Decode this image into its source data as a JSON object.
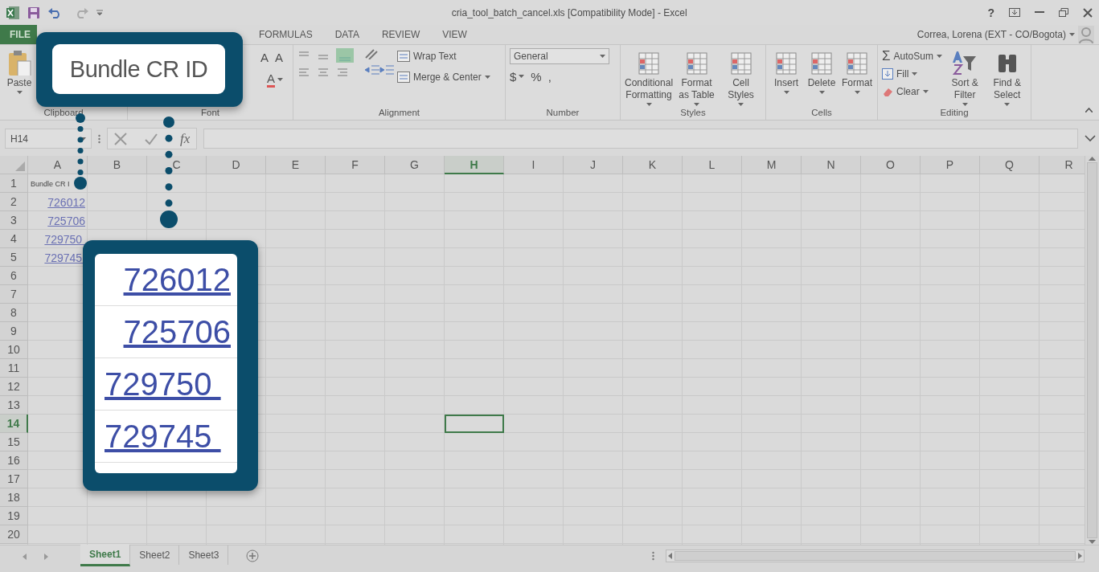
{
  "window": {
    "title": "cria_tool_batch_cancel.xls  [Compatibility Mode] - Excel",
    "help": "?",
    "user": "Correa, Lorena (EXT - CO/Bogota)"
  },
  "ribbon_tabs": [
    {
      "label": "FILE",
      "kind": "file"
    },
    {
      "label": "FORMULAS",
      "kind": "tab"
    },
    {
      "label": "DATA",
      "kind": "tab"
    },
    {
      "label": "REVIEW",
      "kind": "tab"
    },
    {
      "label": "VIEW",
      "kind": "tab"
    }
  ],
  "ribbon_groups": [
    {
      "name": "Clipboard",
      "commands": [
        {
          "kind": "large",
          "label": "Paste",
          "dropdown": true
        }
      ]
    },
    {
      "name": "Font",
      "commands": [
        {
          "kind": "glyph",
          "label": "A"
        },
        {
          "kind": "glyph",
          "label": "A"
        },
        {
          "kind": "color",
          "label": "A",
          "dropdown": true
        }
      ]
    },
    {
      "name": "Alignment",
      "commands": [
        {
          "kind": "small",
          "label": "Wrap Text",
          "dropdown": false
        },
        {
          "kind": "small",
          "label": "Merge & Center",
          "dropdown": true
        }
      ]
    },
    {
      "name": "Number",
      "format": "General",
      "commands": [
        {
          "kind": "glyph",
          "label": "$",
          "dropdown": true
        },
        {
          "kind": "glyph",
          "label": "%"
        },
        {
          "kind": "glyph",
          "label": ","
        }
      ]
    },
    {
      "name": "Styles",
      "commands": [
        {
          "kind": "large",
          "label": "Conditional Formatting",
          "dropdown": true
        },
        {
          "kind": "large",
          "label": "Format as Table",
          "dropdown": true
        },
        {
          "kind": "large",
          "label": "Cell Styles",
          "dropdown": true
        }
      ]
    },
    {
      "name": "Cells",
      "commands": [
        {
          "kind": "large",
          "label": "Insert",
          "dropdown": true
        },
        {
          "kind": "large",
          "label": "Delete",
          "dropdown": true
        },
        {
          "kind": "large",
          "label": "Format",
          "dropdown": true
        }
      ]
    },
    {
      "name": "Editing",
      "commands": [
        {
          "kind": "small",
          "label": "AutoSum",
          "glyph": "Σ",
          "dropdown": true
        },
        {
          "kind": "small",
          "label": "Fill",
          "dropdown": true
        },
        {
          "kind": "small",
          "label": "Clear",
          "dropdown": true
        },
        {
          "kind": "large",
          "label": "Sort & Filter",
          "dropdown": true
        },
        {
          "kind": "large",
          "label": "Find & Select",
          "dropdown": true
        }
      ]
    }
  ],
  "formula_bar": {
    "name_box": "H14",
    "fx": "fx"
  },
  "sheet": {
    "columns": [
      {
        "label": "A",
        "selected": false
      },
      {
        "label": "B",
        "selected": false
      },
      {
        "label": "C",
        "selected": false
      },
      {
        "label": "D",
        "selected": false
      },
      {
        "label": "E",
        "selected": false
      },
      {
        "label": "F",
        "selected": false
      },
      {
        "label": "G",
        "selected": false
      },
      {
        "label": "H",
        "selected": true
      },
      {
        "label": "I",
        "selected": false
      },
      {
        "label": "J",
        "selected": false
      },
      {
        "label": "K",
        "selected": false
      },
      {
        "label": "L",
        "selected": false
      },
      {
        "label": "M",
        "selected": false
      },
      {
        "label": "N",
        "selected": false
      },
      {
        "label": "O",
        "selected": false
      },
      {
        "label": "P",
        "selected": false
      },
      {
        "label": "Q",
        "selected": false
      },
      {
        "label": "R",
        "selected": false
      }
    ],
    "rows": [
      {
        "number": "1",
        "selected": false,
        "cells": [
          {
            "kind": "text",
            "text": "Bundle CR I"
          }
        ]
      },
      {
        "number": "2",
        "selected": false,
        "cells": [
          {
            "kind": "link",
            "text": "726012"
          }
        ]
      },
      {
        "number": "3",
        "selected": false,
        "cells": [
          {
            "kind": "link",
            "text": "725706"
          }
        ]
      },
      {
        "number": "4",
        "selected": false,
        "cells": [
          {
            "kind": "link",
            "text": "729750 "
          }
        ]
      },
      {
        "number": "5",
        "selected": false,
        "cells": [
          {
            "kind": "link",
            "text": "729745 "
          }
        ]
      },
      {
        "number": "6",
        "selected": false
      },
      {
        "number": "7",
        "selected": false
      },
      {
        "number": "8",
        "selected": false
      },
      {
        "number": "9",
        "selected": false
      },
      {
        "number": "10",
        "selected": false
      },
      {
        "number": "11",
        "selected": false
      },
      {
        "number": "12",
        "selected": false
      },
      {
        "number": "13",
        "selected": false
      },
      {
        "number": "14",
        "selected": true
      },
      {
        "number": "15",
        "selected": false
      },
      {
        "number": "16",
        "selected": false
      },
      {
        "number": "17",
        "selected": false
      },
      {
        "number": "18",
        "selected": false
      },
      {
        "number": "19",
        "selected": false
      },
      {
        "number": "20",
        "selected": false
      }
    ]
  },
  "sheet_tabs": [
    {
      "label": "Sheet1",
      "selected": true
    },
    {
      "label": "Sheet2",
      "selected": false
    },
    {
      "label": "Sheet3",
      "selected": false
    }
  ],
  "callouts": [
    {
      "kind": "label",
      "text": "Bundle CR ID"
    },
    {
      "kind": "values",
      "values": [
        "726012",
        "725706",
        "729750 ",
        "729745 "
      ]
    }
  ]
}
